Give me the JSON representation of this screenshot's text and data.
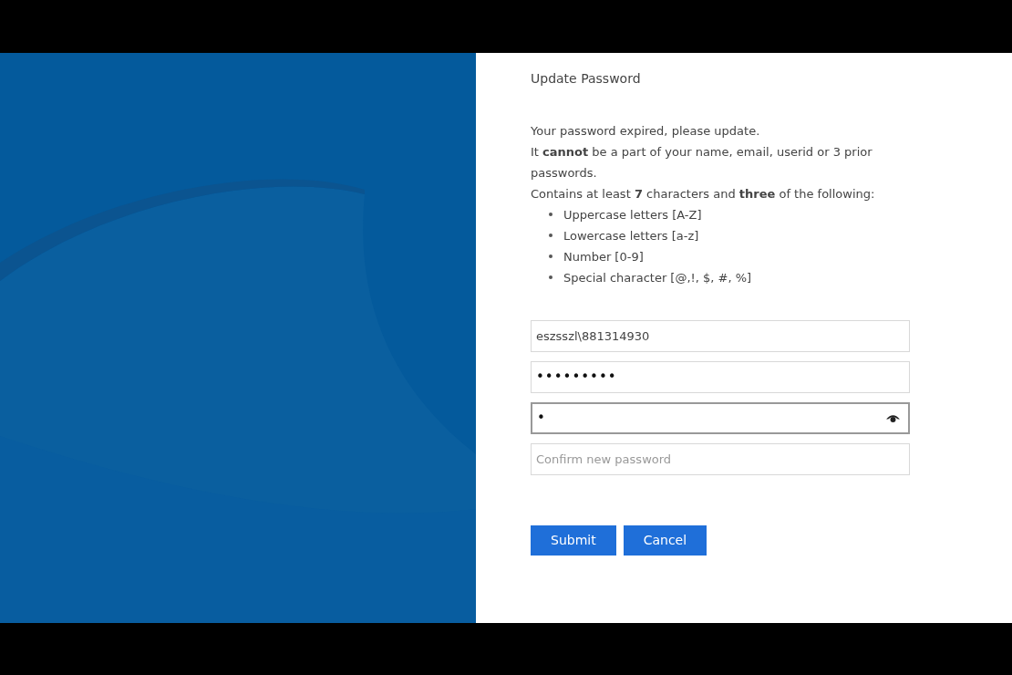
{
  "title": "Update Password",
  "intro": [
    "Your password expired, please update.",
    "It **cannot** be a part of your name, email, userid or 3 prior passwords.",
    "Contains at least **7** characters and **three** of the following:"
  ],
  "rules": [
    "Uppercase letters [A-Z]",
    "Lowercase letters [a-z]",
    "Number [0-9]",
    "Special character [@,!, $, #, %]"
  ],
  "fields": [
    {
      "kind": "text",
      "value": "eszsszl\\881314930",
      "focused": false
    },
    {
      "kind": "password",
      "value": "•••••••••",
      "focused": false
    },
    {
      "kind": "reveal",
      "value": "•",
      "focused": true
    },
    {
      "kind": "text",
      "placeholder": "Confirm new password",
      "focused": false
    }
  ],
  "buttons": [
    "Submit",
    "Cancel"
  ]
}
